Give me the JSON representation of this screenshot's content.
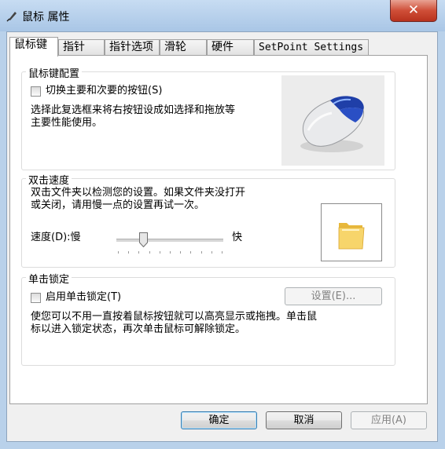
{
  "window": {
    "title": "鼠标 属性"
  },
  "tabs": [
    {
      "label": "鼠标键",
      "active": true
    },
    {
      "label": "指针"
    },
    {
      "label": "指针选项"
    },
    {
      "label": "滑轮"
    },
    {
      "label": "硬件"
    },
    {
      "label": "SetPoint Settings"
    }
  ],
  "buttons_group": {
    "title": "鼠标键配置",
    "switch_label": "切换主要和次要的按钮(S)",
    "switch_checked": false,
    "desc_line1": "选择此复选框来将右按钮设成如选择和拖放等",
    "desc_line2": "主要性能使用。"
  },
  "double_click": {
    "title": "双击速度",
    "desc_line1": "双击文件夹以检测您的设置。如果文件夹没打开",
    "desc_line2": "或关闭，请用慢一点的设置再试一次。",
    "speed_label": "速度(D):慢",
    "fast_label": "快",
    "speed_fraction": 0.23
  },
  "click_lock": {
    "title": "单击锁定",
    "enable_label": "启用单击锁定(T)",
    "enable_checked": false,
    "settings_button": "设置(E)...",
    "desc_line1": "使您可以不用一直按着鼠标按钮就可以高亮显示或拖拽。单击鼠",
    "desc_line2": "标以进入锁定状态，再次单击鼠标可解除锁定。"
  },
  "footer": {
    "ok": "确定",
    "cancel": "取消",
    "apply": "应用(A)"
  },
  "colors": {
    "titlebar": "#b9d1ea",
    "close_button": "#c94b36",
    "default_button_border": "#3c7fb1"
  }
}
